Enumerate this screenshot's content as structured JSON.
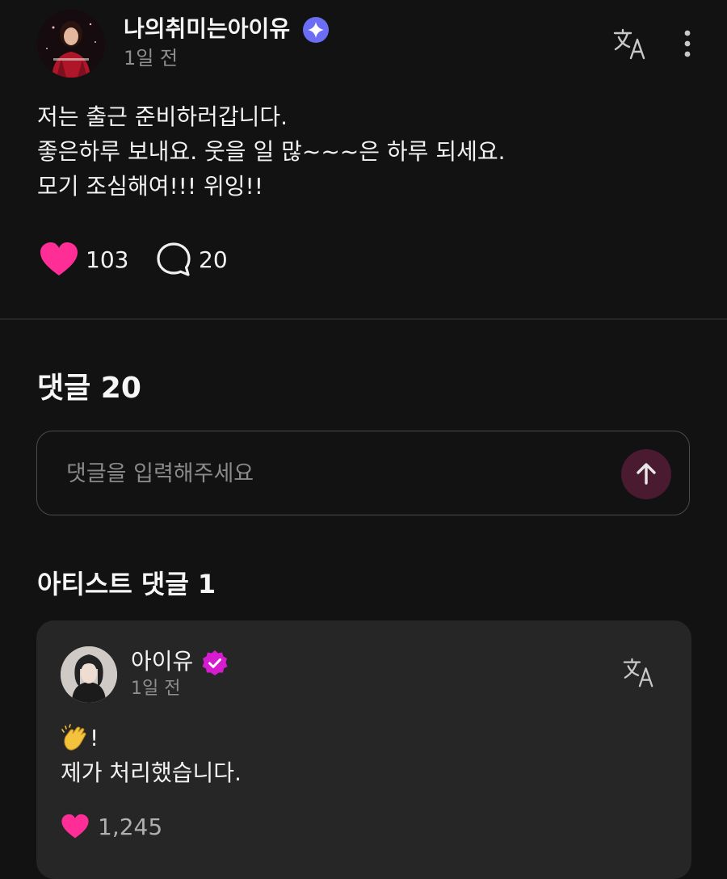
{
  "post": {
    "author": "나의취미는아이유",
    "time": "1일 전",
    "lines": [
      "저는 출근 준비하러갑니다.",
      "좋은하루 보내요. 웃을 일 많~~~은 하루 되세요.",
      "모기 조심해여!!! 위잉!!"
    ],
    "likes": "103",
    "comments": "20"
  },
  "comments_section": {
    "heading": "댓글 20",
    "input_placeholder": "댓글을 입력해주세요"
  },
  "artist_section": {
    "heading": "아티스트 댓글 1",
    "comment": {
      "author": "아이유",
      "time": "1일 전",
      "line1_suffix": "!",
      "line2": "제가 처리했습니다.",
      "likes": "1,245"
    }
  },
  "icons": {
    "verified_fan": "sparkle-badge-icon",
    "verified_artist": "check-badge-icon",
    "translate": "translate-icon",
    "more": "more-vertical-icon",
    "heart": "heart-icon",
    "comment": "comment-bubble-icon",
    "send": "arrow-up-icon",
    "clap": "clapping-hands-icon"
  },
  "colors": {
    "background": "#121212",
    "card": "#262626",
    "heart": "#ff2e97",
    "send_button": "#4a1a31",
    "fan_badge": "#6b6df5",
    "artist_badge": "#d51ccf"
  }
}
